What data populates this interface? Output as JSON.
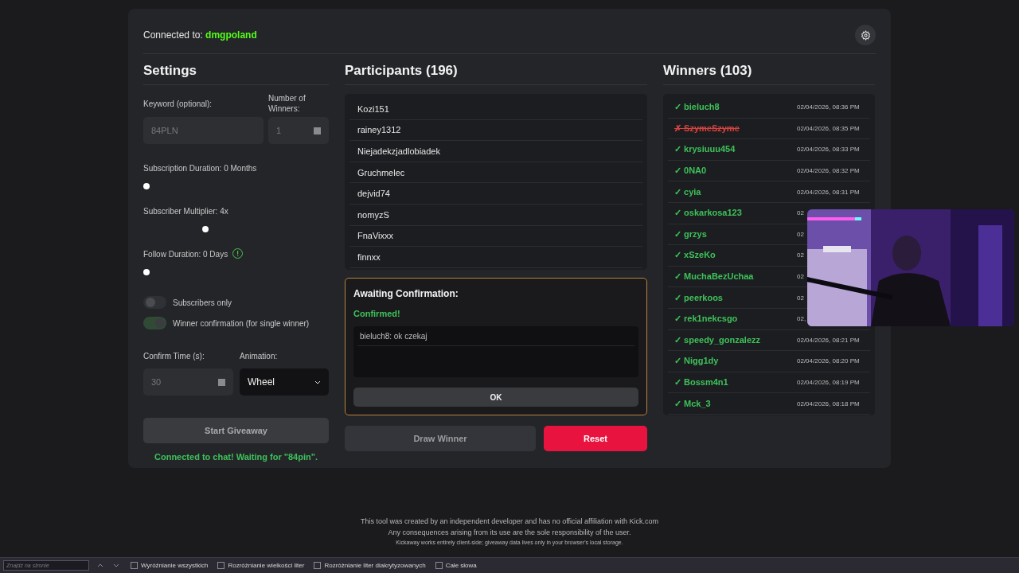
{
  "header": {
    "label": "Connected to:",
    "channel": "dmgpoland"
  },
  "settings": {
    "title": "Settings",
    "keyword": {
      "label": "Keyword (optional):",
      "value": "84PLN",
      "disabled": true
    },
    "winners_count": {
      "label": "Number of Winners:",
      "value": "1",
      "disabled": true
    },
    "sliders": [
      {
        "label": "Subscription Duration: 0 Months",
        "level": 0,
        "info": false
      },
      {
        "label": "Subscriber Multiplier: 4x",
        "level": 0.33,
        "info": false
      },
      {
        "label": "Follow Duration: 0 Days",
        "level": 0,
        "info": true
      }
    ],
    "toggles": [
      {
        "label": "Subscribers only",
        "on": false
      },
      {
        "label": "Winner confirmation (for single winner)",
        "on": true
      }
    ],
    "confirm_time": {
      "label": "Confirm Time (s):",
      "value": "30",
      "disabled": true
    },
    "animation": {
      "label": "Animation:",
      "value": "Wheel"
    },
    "start_button": "Start Giveaway",
    "status": "Connected to chat! Waiting for \"84pin\"."
  },
  "participants": {
    "title": "Participants (196)",
    "names": [
      "Kozi151",
      "rainey1312",
      "Niejadekzjadlobiadek",
      "Gruchmelec",
      "dejvid74",
      "nomyzS",
      "FnaVixxx",
      "finnxx"
    ]
  },
  "confirmation": {
    "title": "Awaiting Confirmation:",
    "status": "Confirmed!",
    "messages": [
      "bieluch8: ok czekaj"
    ],
    "ok_button": "OK"
  },
  "actions": {
    "draw": "Draw Winner",
    "reset": "Reset"
  },
  "winners": {
    "title": "Winners (103)",
    "rows": [
      {
        "kind": "confirmed",
        "mark": "✓",
        "name": "bieluch8",
        "date": "02/04/2026, 08:36 PM"
      },
      {
        "kind": "rejected",
        "mark": "✗",
        "name": "SzymeSzyme",
        "date": "02/04/2026, 08:35 PM"
      },
      {
        "kind": "confirmed",
        "mark": "✓",
        "name": "krysiuuu454",
        "date": "02/04/2026, 08:33 PM"
      },
      {
        "kind": "confirmed",
        "mark": "✓",
        "name": "0NA0",
        "date": "02/04/2026, 08:32 PM"
      },
      {
        "kind": "confirmed",
        "mark": "✓",
        "name": "cyia",
        "date": "02/04/2026, 08:31 PM"
      },
      {
        "kind": "confirmed",
        "mark": "✓",
        "name": "oskarkosa123",
        "date": "02"
      },
      {
        "kind": "confirmed",
        "mark": "✓",
        "name": "grzys",
        "date": "02"
      },
      {
        "kind": "confirmed",
        "mark": "✓",
        "name": "xSzeKo",
        "date": "02"
      },
      {
        "kind": "confirmed",
        "mark": "✓",
        "name": "MuchaBezUchaa",
        "date": "02"
      },
      {
        "kind": "confirmed",
        "mark": "✓",
        "name": "peerkoos",
        "date": "02"
      },
      {
        "kind": "confirmed",
        "mark": "✓",
        "name": "rek1nekcsgo",
        "date": "02,"
      },
      {
        "kind": "confirmed",
        "mark": "✓",
        "name": "speedy_gonzalezz",
        "date": "02/04/2026, 08:21 PM"
      },
      {
        "kind": "confirmed",
        "mark": "✓",
        "name": "Nigg1dy",
        "date": "02/04/2026, 08:20 PM"
      },
      {
        "kind": "confirmed",
        "mark": "✓",
        "name": "Bossm4n1",
        "date": "02/04/2026, 08:19 PM"
      },
      {
        "kind": "confirmed",
        "mark": "✓",
        "name": "Mck_3",
        "date": "02/04/2026, 08:18 PM"
      }
    ]
  },
  "webcam": {
    "kind": "picture"
  },
  "footer": [
    "This tool was created by an independent developer and has no official affiliation with Kick.com",
    "Any consequences arising from its use are the sole responsibility of the user.",
    "Kickaway works entirely client-side; giveaway data lives only in your browser's local storage."
  ],
  "find_bar": {
    "placeholder": "Znajdź na stronie",
    "options": [
      {
        "label": "Wyróżnianie wszystkich",
        "checked": false
      },
      {
        "label": "Rozróżnianie wielkości liter",
        "checked": false
      },
      {
        "label": "Rozróżnianie liter diakrytyzowanych",
        "checked": false
      },
      {
        "label": "Całe słowa",
        "checked": false
      }
    ]
  }
}
